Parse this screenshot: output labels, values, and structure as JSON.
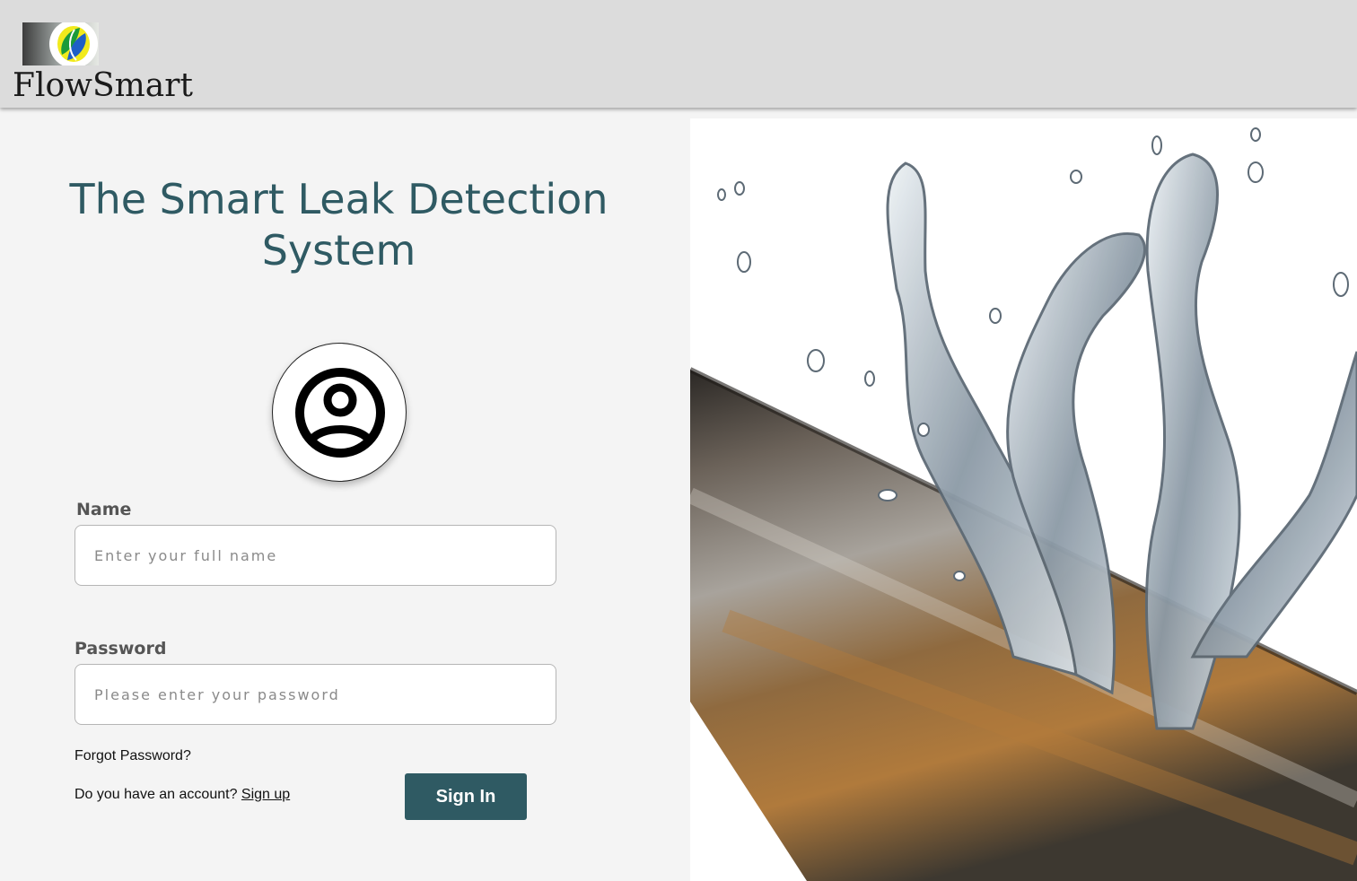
{
  "header": {
    "brand_name": "FlowSmart",
    "logo_icon": "flowsmart-leaf-logo"
  },
  "login": {
    "headline": "The Smart Leak Detection System",
    "avatar_icon": "user-circle-icon",
    "name_label": "Name",
    "name_placeholder": "Enter your full name",
    "name_value": "",
    "password_label": "Password",
    "password_placeholder": "Please enter your password",
    "password_value": "",
    "forgot_password": "Forgot Password?",
    "account_prompt": "Do you have an account? ",
    "signup_link": "Sign up",
    "signin_button": "Sign In"
  },
  "hero": {
    "image": "water-splashing-from-rusty-pipe"
  },
  "colors": {
    "accent": "#2f5a63",
    "header_bg": "#dcdcdc",
    "page_bg": "#f4f4f4"
  }
}
